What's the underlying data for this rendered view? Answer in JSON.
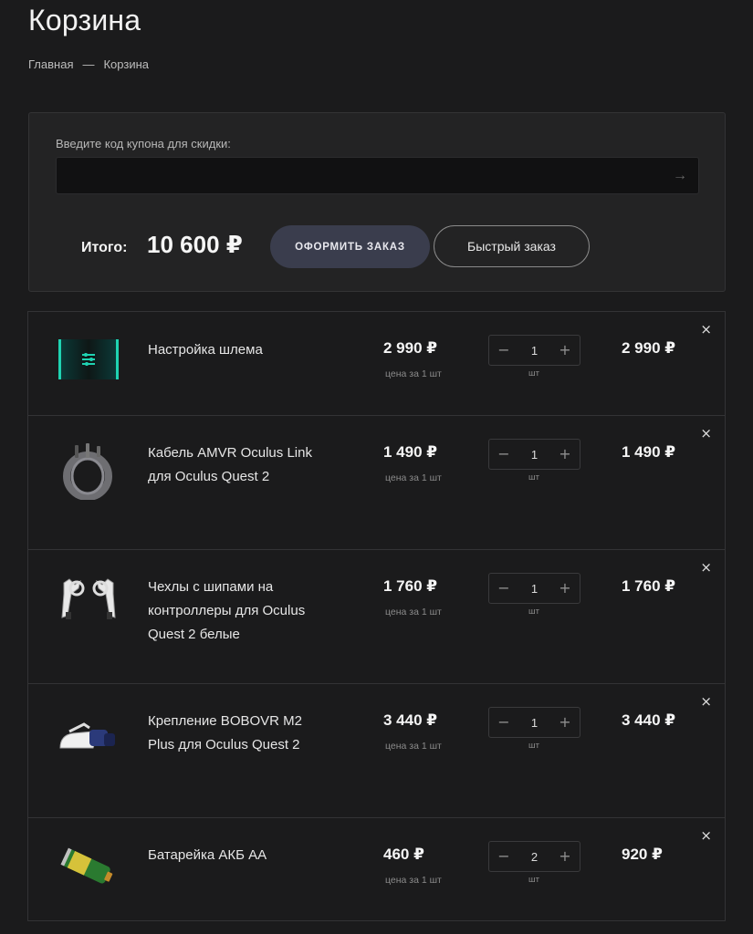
{
  "page": {
    "title": "Корзина"
  },
  "breadcrumb": {
    "home": "Главная",
    "separator": "—",
    "current": "Корзина"
  },
  "coupon": {
    "label": "Введите код купона для скидки:",
    "value": "",
    "submit_icon": "arrow-right-icon"
  },
  "summary": {
    "total_label": "Итого:",
    "total_value": "10 600 ₽"
  },
  "actions": {
    "order_label": "Оформить заказ",
    "quick_label": "Быстрый заказ"
  },
  "cart": {
    "unit_caption": "цена за 1 шт",
    "qty_unit": "шт",
    "minus": "−",
    "plus": "+",
    "remove": "×",
    "items": [
      {
        "name": "Настройка шлема",
        "price": "2 990 ₽",
        "qty": "1",
        "total": "2 990 ₽",
        "thumb": "vr-setup-card"
      },
      {
        "name": "Кабель AMVR Oculus Link для Oculus Quest 2",
        "price": "1 490 ₽",
        "qty": "1",
        "total": "1 490 ₽",
        "thumb": "cable-coil"
      },
      {
        "name": "Чехлы с шипами на контроллеры для Oculus Quest 2 белые",
        "price": "1 760 ₽",
        "qty": "1",
        "total": "1 760 ₽",
        "thumb": "spiked-controllers"
      },
      {
        "name": "Крепление BOBOVR M2 Plus для Oculus Quest 2",
        "price": "3 440 ₽",
        "qty": "1",
        "total": "3 440 ₽",
        "thumb": "head-strap"
      },
      {
        "name": "Батарейка АКБ АА",
        "price": "460 ₽",
        "qty": "2",
        "total": "920 ₽",
        "thumb": "aa-battery"
      }
    ]
  },
  "colors": {
    "background": "#1b1b1c",
    "panel": "#232324",
    "order_button": "#3a3d4d",
    "accent_teal": "#1fd3b2"
  }
}
